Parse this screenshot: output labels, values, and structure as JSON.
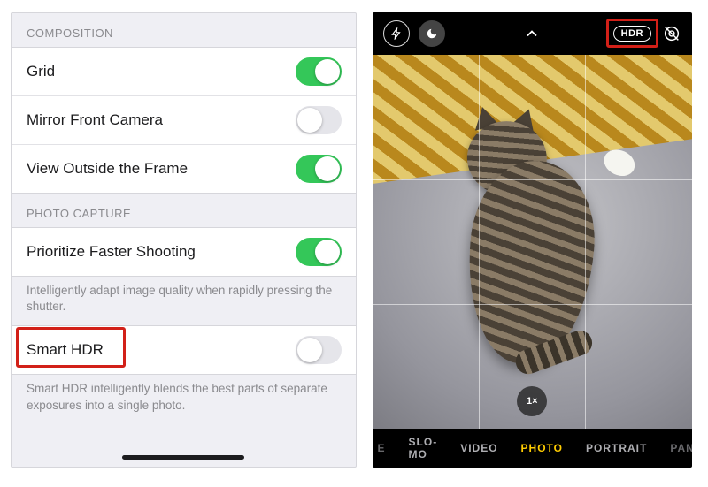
{
  "settings": {
    "sections": [
      {
        "header": "COMPOSITION",
        "rows": [
          {
            "label": "Grid",
            "value": true
          },
          {
            "label": "Mirror Front Camera",
            "value": false
          },
          {
            "label": "View Outside the Frame",
            "value": true
          }
        ]
      },
      {
        "header": "PHOTO CAPTURE",
        "rows": [
          {
            "label": "Prioritize Faster Shooting",
            "value": true
          }
        ],
        "footer": "Intelligently adapt image quality when rapidly pressing the shutter."
      },
      {
        "rows": [
          {
            "label": "Smart HDR",
            "value": false,
            "highlighted": true
          }
        ],
        "footer": "Smart HDR intelligently blends the best parts of separate exposures into a single photo."
      }
    ]
  },
  "camera": {
    "top": {
      "flash_icon": "flash",
      "night_icon": "night-mode",
      "expand_icon": "chevron-up",
      "hdr_badge": "HDR",
      "hdr_highlighted": true,
      "live_off_icon": "live-photo-off"
    },
    "viewfinder": {
      "subject": "cat lying on grey surface with yellow patterned rug behind",
      "grid_visible": true,
      "zoom_label": "1×"
    },
    "modes": [
      {
        "label": "E",
        "active": false,
        "edge": true
      },
      {
        "label": "SLO-MO",
        "active": false
      },
      {
        "label": "VIDEO",
        "active": false
      },
      {
        "label": "PHOTO",
        "active": true
      },
      {
        "label": "PORTRAIT",
        "active": false
      },
      {
        "label": "PANO",
        "active": false,
        "edge": true
      }
    ]
  }
}
